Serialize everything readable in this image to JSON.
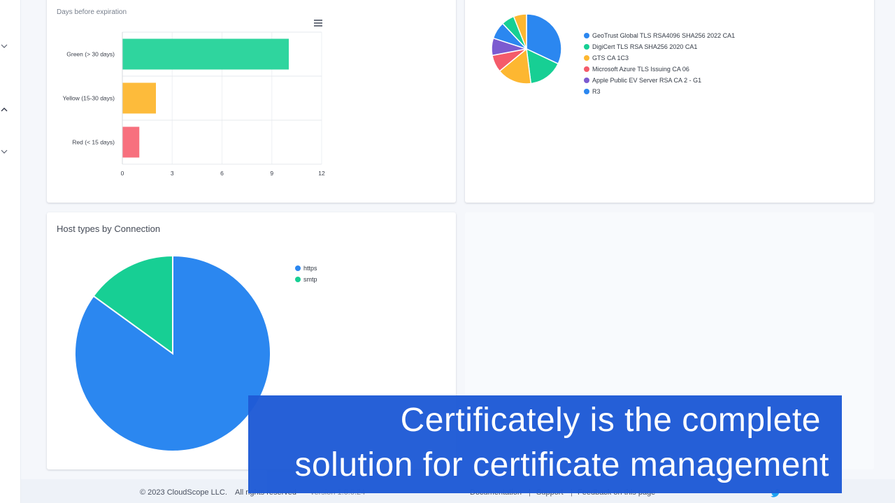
{
  "expiration_card": {
    "subtitle": "Days before expiration",
    "menu_icon": "hamburger-menu-icon",
    "chart_data": {
      "type": "bar",
      "orientation": "horizontal",
      "categories": [
        "Green (> 30 days)",
        "Yellow (15-30 days)",
        "Red (< 15 days)"
      ],
      "values": [
        10,
        2,
        1
      ],
      "colors": [
        "#2fd59e",
        "#fdbb3b",
        "#f7707e"
      ],
      "xlim": [
        0,
        12
      ],
      "xticks": [
        "0",
        "3",
        "6",
        "9",
        "12"
      ],
      "grid": true
    }
  },
  "issuer_card": {
    "chart_data": {
      "type": "pie",
      "series": [
        {
          "name": "GeoTrust Global TLS RSA4096 SHA256 2022 CA1",
          "value": 32,
          "color": "#2b87f0"
        },
        {
          "name": "DigiCert TLS RSA SHA256 2020 CA1",
          "value": 16,
          "color": "#17cf94"
        },
        {
          "name": "GTS CA 1C3",
          "value": 16,
          "color": "#fdb731"
        },
        {
          "name": "Microsoft Azure TLS Issuing CA 06",
          "value": 8,
          "color": "#f45b6a"
        },
        {
          "name": "Apple Public EV Server RSA CA 2 - G1",
          "value": 8,
          "color": "#7c5bd0"
        },
        {
          "name": "R3",
          "value": 8,
          "color": "#2b87f0"
        },
        {
          "name": "",
          "value": 6,
          "color": "#17cf94"
        },
        {
          "name": "",
          "value": 6,
          "color": "#fdb731"
        }
      ],
      "legend_position": "right"
    }
  },
  "host_card": {
    "title": "Host types by Connection",
    "chart_data": {
      "type": "pie",
      "series": [
        {
          "name": "https",
          "value": 85,
          "color": "#2b87f0"
        },
        {
          "name": "smtp",
          "value": 15,
          "color": "#17cf94"
        }
      ],
      "legend_position": "top-right"
    }
  },
  "footer": {
    "copyright": "© 2023 CloudScope LLC.",
    "rights": "All rights reserved",
    "version": "version 1.0.0.24",
    "links": [
      "Documentation",
      "Support",
      "Feedback on this page"
    ],
    "separator": "|",
    "twitter_icon": "twitter-icon"
  },
  "caption": {
    "line1": "Certificately is the complete",
    "line2": "solution for certificate management"
  },
  "rail": {
    "icons": [
      "chevron-down-icon",
      "chevron-up-icon",
      "chevron-down-icon"
    ]
  },
  "colors": {
    "caption_bg": "#1f5bd6",
    "page_bg": "#f5f7fb"
  }
}
